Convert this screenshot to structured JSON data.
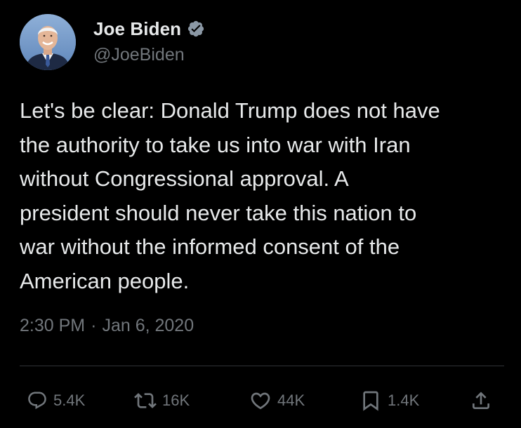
{
  "author": {
    "display_name": "Joe Biden",
    "handle": "@JoeBiden",
    "verified": true,
    "verified_color": "#1d9bf0",
    "avatar_icon": "profile-photo"
  },
  "tweet": {
    "text": "Let's be clear: Donald Trump does not have\nthe authority to take us into war with Iran\nwithout Congressional approval. A\npresident should never take this nation to\nwar without the informed consent of the\nAmerican people.",
    "time": "2:30 PM",
    "separator": "·",
    "date": "Jan 6, 2020"
  },
  "actions": {
    "reply": {
      "icon": "reply-icon",
      "count": "5.4K"
    },
    "retweet": {
      "icon": "retweet-icon",
      "count": "16K"
    },
    "like": {
      "icon": "heart-icon",
      "count": "44K"
    },
    "bookmark": {
      "icon": "bookmark-icon",
      "count": "1.4K"
    },
    "share": {
      "icon": "share-icon"
    }
  },
  "colors": {
    "background": "#000000",
    "primary_text": "#e7e9ea",
    "secondary_text": "#71767b",
    "divider": "#2f3336"
  }
}
